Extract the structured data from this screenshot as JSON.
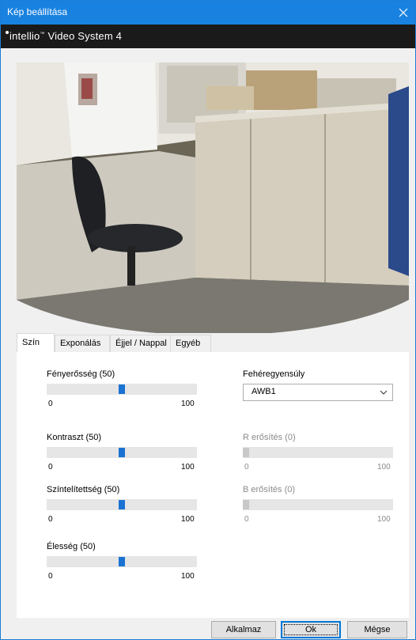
{
  "window": {
    "title": "Kép beállítása"
  },
  "brand": {
    "name": "intellio",
    "product": "Video System 4"
  },
  "tabs": [
    "Szín",
    "Exponálás",
    "Éjjel / Nappal",
    "Egyéb"
  ],
  "active_tab": 0,
  "left_sliders": [
    {
      "label": "Fényerősség (50)",
      "value": 50,
      "min": "0",
      "max": "100"
    },
    {
      "label": "Kontraszt (50)",
      "value": 50,
      "min": "0",
      "max": "100"
    },
    {
      "label": "Színtelítettség (50)",
      "value": 50,
      "min": "0",
      "max": "100"
    },
    {
      "label": "Élesség (50)",
      "value": 50,
      "min": "0",
      "max": "100"
    }
  ],
  "white_balance": {
    "label": "Fehéregyensúly",
    "selected": "AWB1"
  },
  "right_sliders": [
    {
      "label": "R erősítés (0)",
      "value": 0,
      "min": "0",
      "max": "100"
    },
    {
      "label": "B erősítés (0)",
      "value": 0,
      "min": "0",
      "max": "100"
    }
  ],
  "buttons": {
    "apply": "Alkalmaz",
    "ok": "Ok",
    "cancel": "Mégse"
  },
  "colors": {
    "titlebar": "#1982e0",
    "brandbar": "#1a1a1a",
    "slider_thumb": "#1a73d2"
  }
}
